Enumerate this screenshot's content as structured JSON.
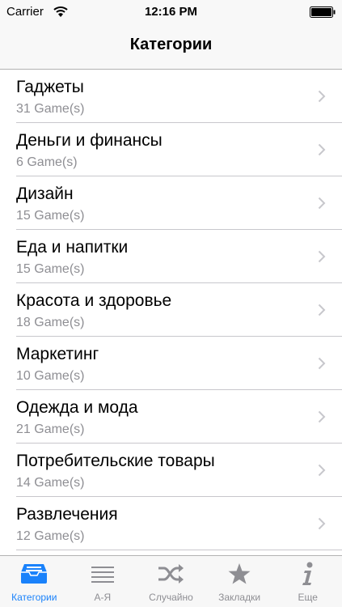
{
  "status_bar": {
    "carrier": "Carrier",
    "time": "12:16 PM"
  },
  "nav": {
    "title": "Категории"
  },
  "categories": [
    {
      "title": "Гаджеты",
      "count": "31 Game(s)"
    },
    {
      "title": "Деньги и финансы",
      "count": "6 Game(s)"
    },
    {
      "title": "Дизайн",
      "count": "15 Game(s)"
    },
    {
      "title": "Еда и напитки",
      "count": "15 Game(s)"
    },
    {
      "title": "Красота и здоровье",
      "count": "18 Game(s)"
    },
    {
      "title": "Маркетинг",
      "count": "10 Game(s)"
    },
    {
      "title": "Одежда и мода",
      "count": "21 Game(s)"
    },
    {
      "title": "Потребительские товары",
      "count": "14 Game(s)"
    },
    {
      "title": "Развлечения",
      "count": "12 Game(s)"
    }
  ],
  "tabs": [
    {
      "label": "Категории",
      "icon": "inbox-tray-icon",
      "active": true
    },
    {
      "label": "А-Я",
      "icon": "list-lines-icon",
      "active": false
    },
    {
      "label": "Случайно",
      "icon": "shuffle-icon",
      "active": false
    },
    {
      "label": "Закладки",
      "icon": "star-icon",
      "active": false
    },
    {
      "label": "Еще",
      "icon": "info-icon",
      "active": false
    }
  ],
  "colors": {
    "accent": "#1a82fb",
    "inactive": "#8e8e93",
    "separator": "#c8c7cc"
  }
}
